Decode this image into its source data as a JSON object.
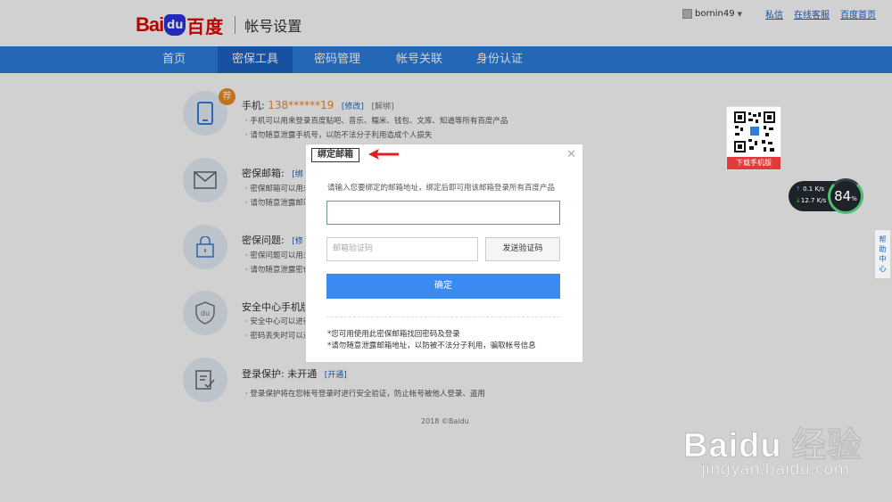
{
  "header": {
    "logo_bai": "Bai",
    "logo_du": "du",
    "logo_cn": "百度",
    "page_title": "帐号设置",
    "username": "bornin49",
    "links": [
      "私信",
      "在线客服",
      "百度首页"
    ]
  },
  "nav": {
    "items": [
      "首页",
      "密保工具",
      "密码管理",
      "帐号关联",
      "身份认证"
    ],
    "active_index": 1
  },
  "items": [
    {
      "title": "手机:",
      "value": "138******19",
      "link1": "[修改]",
      "link2": "[解绑]",
      "badge": "荐",
      "desc": [
        "· 手机可以用来登录百度贴吧、音乐、糯米、钱包、文库、知道等所有百度产品",
        "· 请勿随意泄露手机号，以防不法分子利用造成个人损失"
      ]
    },
    {
      "title": "密保邮箱:",
      "link1": "[绑",
      "desc": [
        "· 密保邮箱可以用来",
        "· 请勿随意泄露邮箱信息"
      ]
    },
    {
      "title": "密保问题:",
      "link1": "[修",
      "desc": [
        "· 密保问题可以用来",
        "· 请勿随意泄露密保问"
      ]
    },
    {
      "title": "安全中心手机版",
      "desc": [
        "· 安全中心可以进行",
        "· 密码丢失时可以通"
      ]
    },
    {
      "title": "登录保护: 未开通",
      "link1": "[开通]",
      "desc": [
        "· 登录保护将在您帐号登录时进行安全验证，防止帐号被他人登录、盗用"
      ]
    }
  ],
  "footer": {
    "copyright": "2018 ©Baidu"
  },
  "widgets": {
    "qr_button": "下载手机版",
    "speed_up": "0.1",
    "speed_down": "12.7",
    "speed_unit": "K/s",
    "percent": "84",
    "percent_unit": "%",
    "help": [
      "帮",
      "助",
      "中",
      "心"
    ]
  },
  "dialog": {
    "title": "绑定邮箱",
    "tip": "请输入您要绑定的邮箱地址，绑定后即可用该邮箱登录所有百度产品",
    "email_value": "",
    "code_placeholder": "邮箱验证码",
    "send_label": "发送验证码",
    "confirm_label": "确定",
    "note1": "*您可用使用此密保邮箱找回密码及登录",
    "note2": "*请勿随意泄露邮箱地址，以防被不法分子利用，骗取帐号信息"
  },
  "watermark": {
    "big": "Bai",
    "du": "du",
    "cn": "经验",
    "url": "jingyan.baidu.com"
  },
  "colors": {
    "nav": "#2e7ee0",
    "nav_active": "#1b63c6",
    "accent_orange": "#f08a24",
    "confirm": "#3b8af2",
    "logo_red": "#e10602"
  }
}
